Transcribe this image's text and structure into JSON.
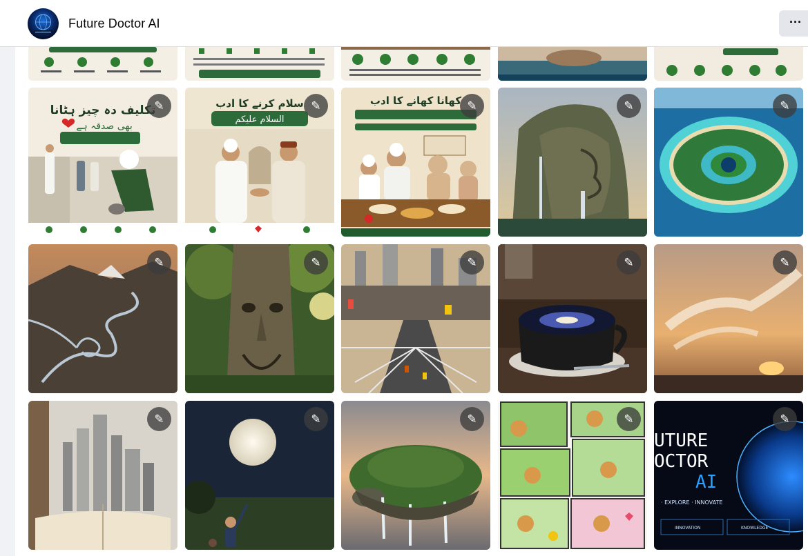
{
  "header": {
    "title": "Future Doctor AI",
    "avatar_icon": "globe-logo-icon",
    "more_label": "···",
    "more_icon": "more-options-icon"
  },
  "gallery": {
    "edit_icon_glyph": "✎",
    "tiles": [
      {
        "name": "photo-urdu-infographic-1"
      },
      {
        "name": "photo-urdu-infographic-2"
      },
      {
        "name": "photo-urdu-infographic-3"
      },
      {
        "name": "photo-waterfall-boat"
      },
      {
        "name": "photo-urdu-infographic-4"
      },
      {
        "name": "photo-boy-helping-street"
      },
      {
        "name": "photo-greeting-handshake"
      },
      {
        "name": "photo-family-dining"
      },
      {
        "name": "photo-cliff-face-waterfall"
      },
      {
        "name": "photo-eye-shaped-island"
      },
      {
        "name": "photo-mountain-river-valley"
      },
      {
        "name": "photo-tree-face"
      },
      {
        "name": "photo-city-aerial-crossing"
      },
      {
        "name": "photo-galaxy-coffee-cup"
      },
      {
        "name": "photo-sunset-cloud-dragon"
      },
      {
        "name": "photo-book-city"
      },
      {
        "name": "photo-boy-moon"
      },
      {
        "name": "photo-turtle-island"
      },
      {
        "name": "photo-puppy-comic"
      },
      {
        "name": "photo-future-doctor-poster"
      }
    ]
  },
  "text_overlays": {
    "boy_helping_title": "تکلیف دہ چیز ہٹانا",
    "boy_helping_sub": "بھی صدقہ ہے",
    "greeting_title": "سلام کرنے کا ادب",
    "greeting_sub": "السلام علیکم",
    "dining_title": "کھانا کھانے کا ادب",
    "poster_line1": "UTURE",
    "poster_line2": "OCTOR",
    "poster_line3": "AI",
    "poster_tagline": "· EXPLORE · INNOVATE",
    "poster_badge1": "INNOVATION",
    "poster_badge2": "KNOWLEDGE"
  },
  "colors": {
    "header_bg": "#ffffff",
    "page_bg": "#f0f2f5",
    "edit_btn_bg": "#3c3c3c",
    "urdu_green": "#1f5c2e",
    "poster_blue": "#1e90ff"
  }
}
